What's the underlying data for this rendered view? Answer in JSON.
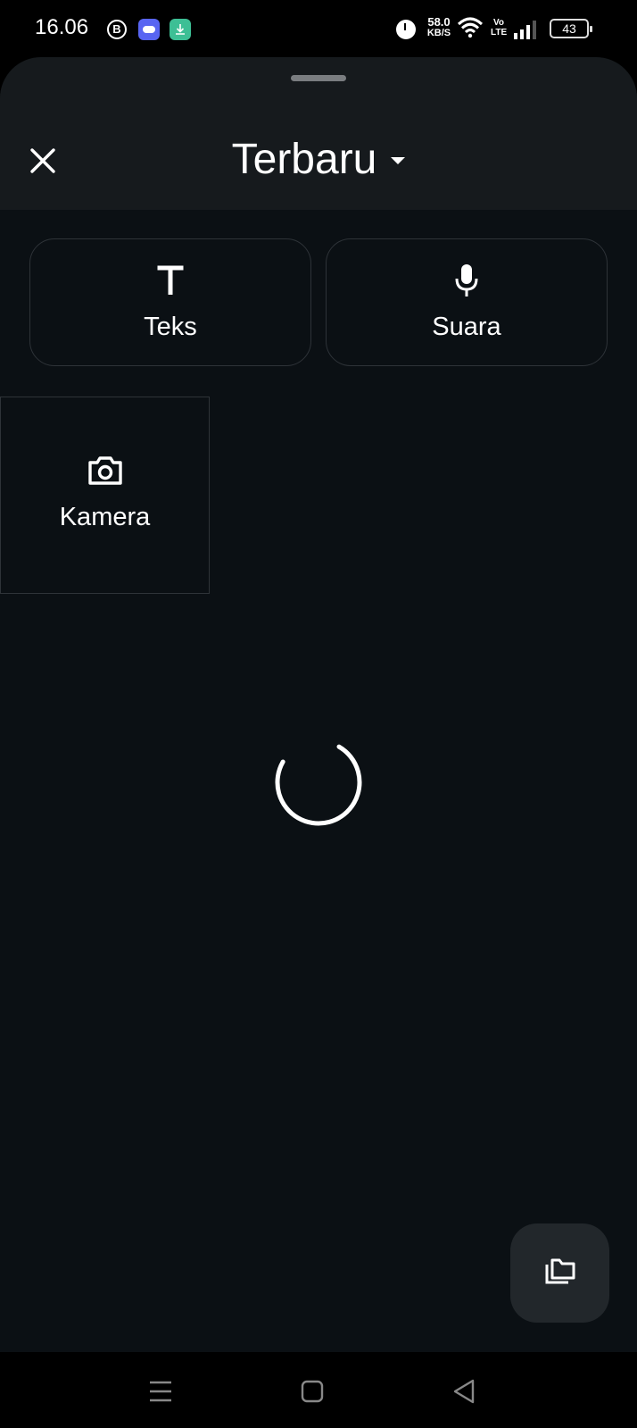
{
  "status_bar": {
    "time": "16.06",
    "b_icon_letter": "B",
    "net_speed_value": "58.0",
    "net_speed_unit": "KB/S",
    "volte_top": "Vo",
    "volte_bottom": "LTE",
    "battery_level": "43",
    "icons": [
      "b-notification-icon",
      "discord-icon",
      "download-icon",
      "alarm-icon",
      "wifi-icon",
      "signal-icon",
      "battery-icon"
    ]
  },
  "sheet": {
    "title": "Terbaru",
    "options": [
      {
        "label": "Teks",
        "icon": "text-icon"
      },
      {
        "label": "Suara",
        "icon": "microphone-icon"
      },
      {
        "label": "Kamera",
        "icon": "camera-icon"
      }
    ],
    "fab_icon": "gallery-folder-icon"
  },
  "colors": {
    "sheet_background": "#0b1014",
    "header_background": "#161a1d",
    "card_border": "#2e3338",
    "fab_background": "#22272b",
    "text": "#ffffff"
  },
  "nav_bar": {
    "icons": [
      "menu-icon",
      "home-icon",
      "back-icon"
    ]
  }
}
